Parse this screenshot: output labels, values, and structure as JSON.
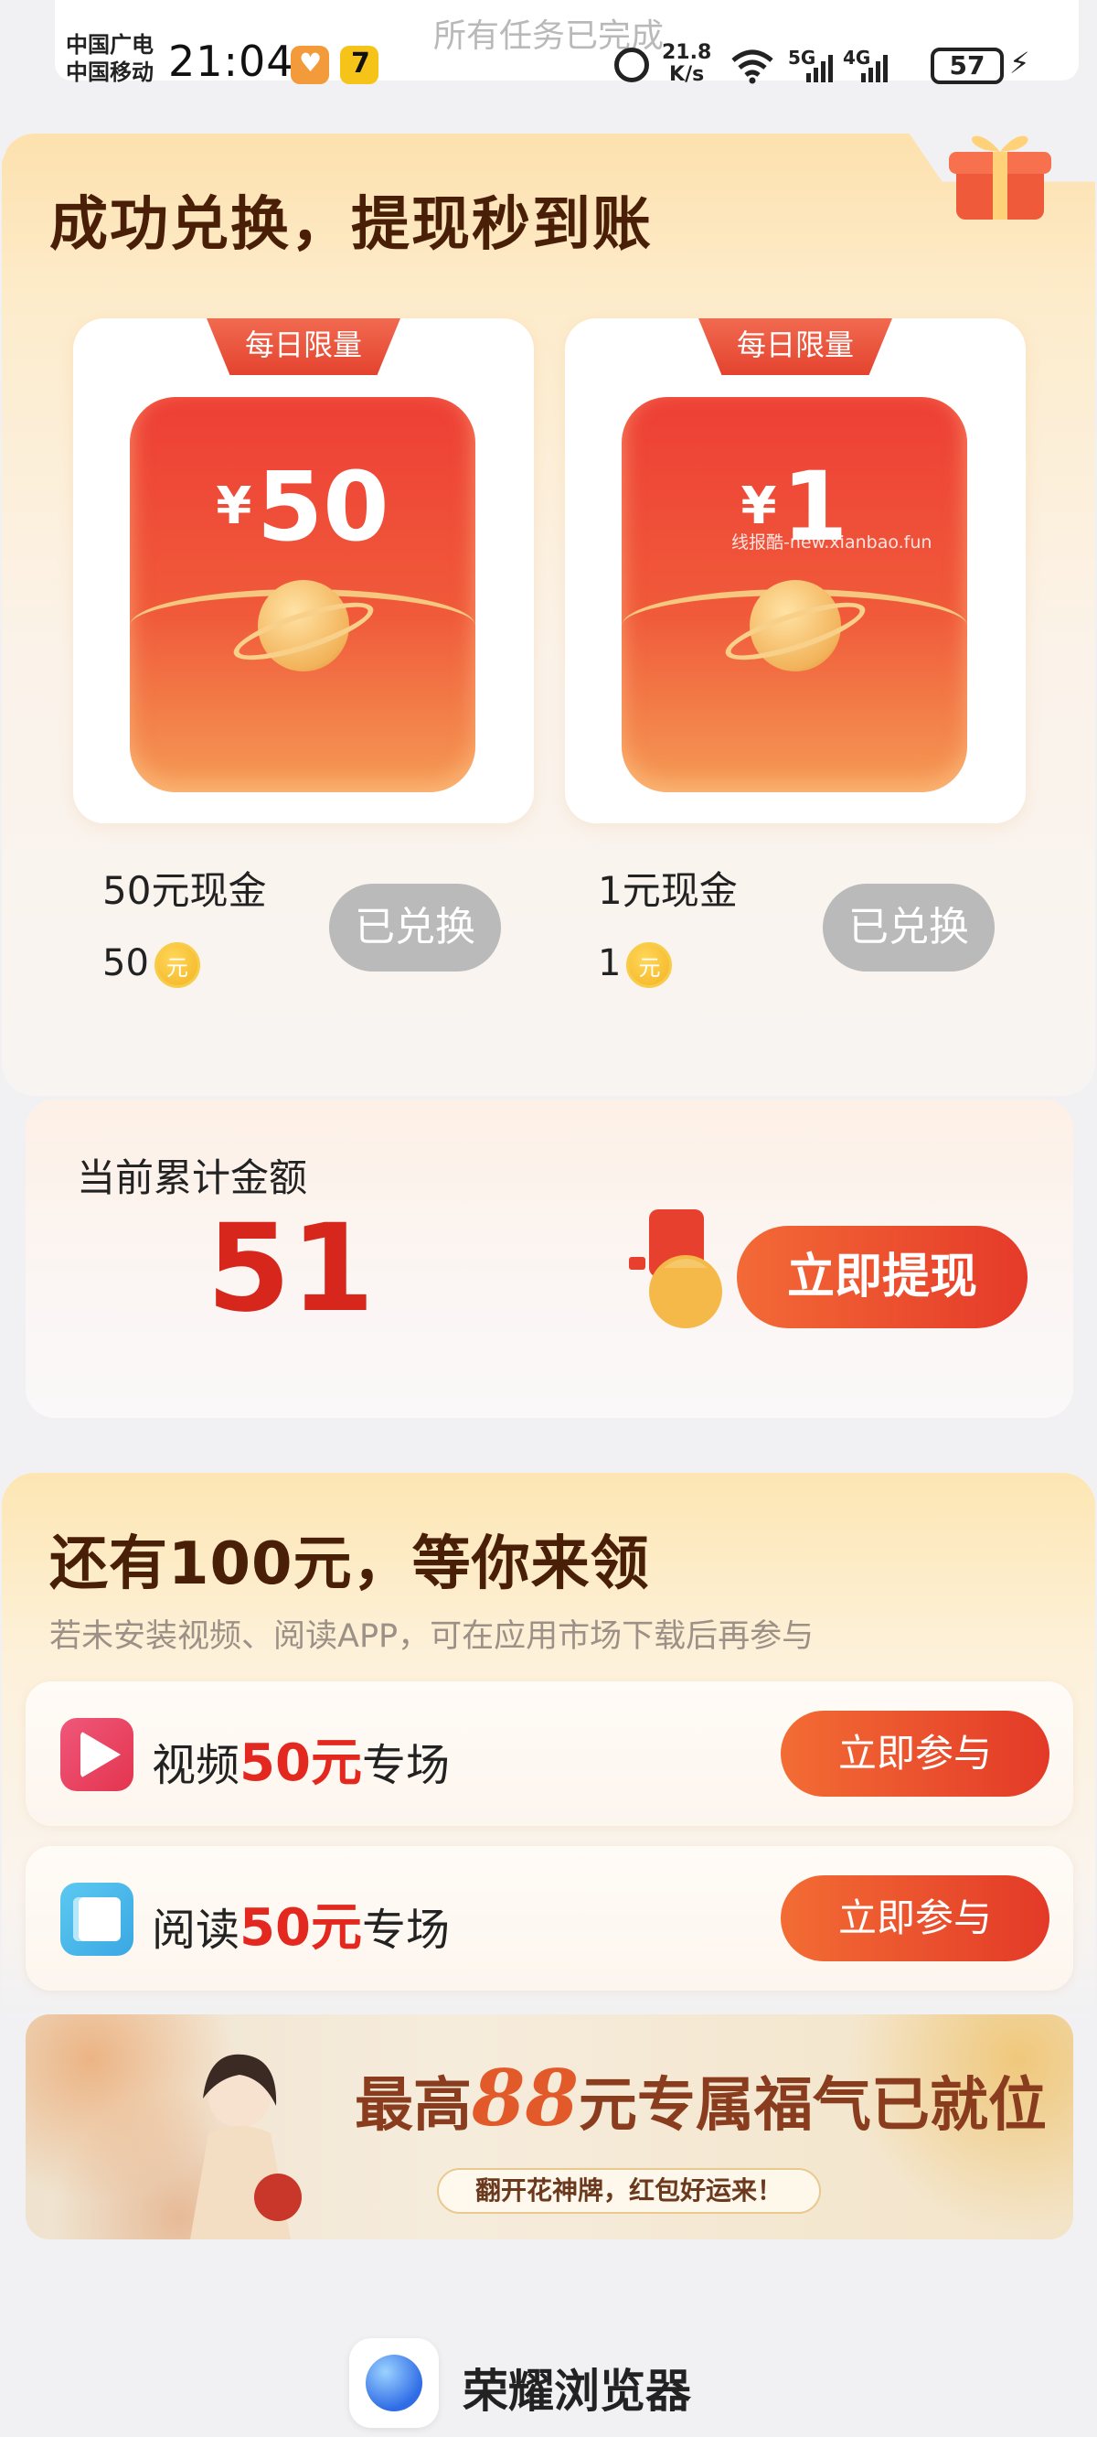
{
  "status_bar": {
    "carrier_1": "中国广电",
    "carrier_2": "中国移动",
    "time": "21:04",
    "network_speed_value": "21.8",
    "network_speed_unit": "K/s",
    "network_5g": "5G",
    "network_4g": "4G",
    "battery": "57",
    "icons": [
      "heart-app-icon",
      "seven-app-icon",
      "alarm-icon",
      "wifi-icon",
      "signal-icon",
      "battery-icon",
      "charging-icon"
    ]
  },
  "toast": {
    "text": "所有任务已完成"
  },
  "exchange": {
    "title": "成功兑换，提现秒到账",
    "prizes": [
      {
        "tag": "每日限量",
        "currency": "¥",
        "amount": "50",
        "name": "50元现金",
        "cost": "50",
        "coin_label": "元",
        "button": "已兑换"
      },
      {
        "tag": "每日限量",
        "currency": "¥",
        "amount": "1",
        "name": "1元现金",
        "cost": "1",
        "coin_label": "元",
        "button": "已兑换"
      }
    ],
    "watermark": "线报酷-new.xianbao.fun"
  },
  "total": {
    "label": "当前累计金额",
    "value": "51",
    "button": "立即提现"
  },
  "tasks": {
    "title": "还有100元，等你来领",
    "subtitle": "若未安装视频、阅读APP，可在应用市场下载后再参与",
    "items": [
      {
        "pre": "视频",
        "amount": "50元",
        "post": "专场",
        "button": "立即参与",
        "icon": "video-icon"
      },
      {
        "pre": "阅读",
        "amount": "50元",
        "post": "专场",
        "button": "立即参与",
        "icon": "book-icon"
      }
    ]
  },
  "banner": {
    "headline_pre": "最高",
    "headline_amount": "88",
    "headline_post": "元专属福气已就位",
    "subtitle": "翻开花神牌，红包好运来！"
  },
  "footer": {
    "app_name": "荣耀浏览器"
  },
  "colors": {
    "accent_red": "#e3291f",
    "button_orange": "#f36c34",
    "title_brown": "#4a1f08",
    "redeemed_gray": "#bababa"
  }
}
